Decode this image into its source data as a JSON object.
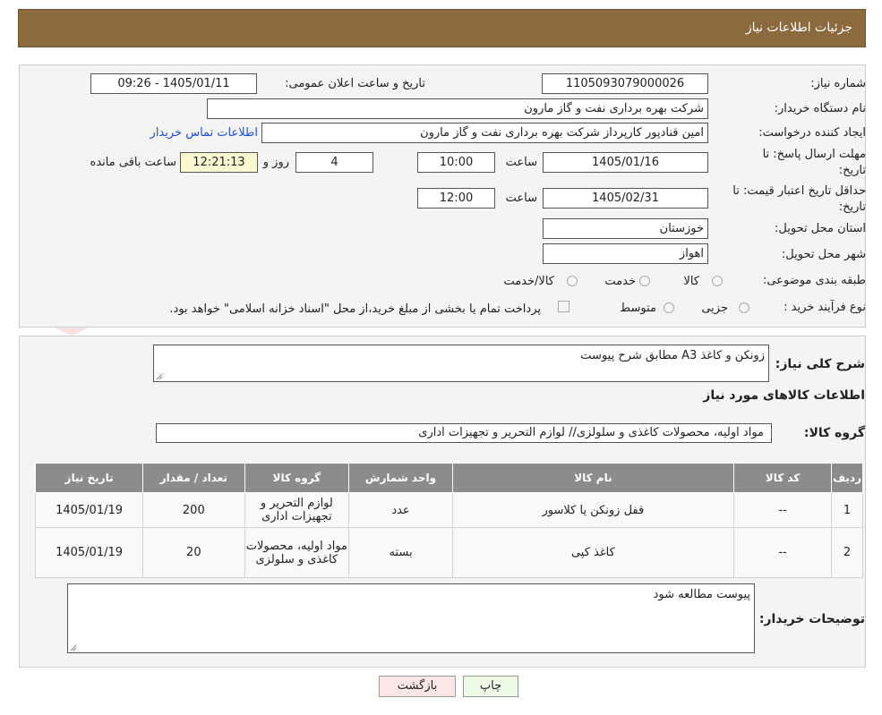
{
  "header": {
    "title": "جزئیات اطلاعات نیاز"
  },
  "form": {
    "need_number_label": "شماره نیاز:",
    "need_number": "1105093079000026",
    "announce_label": "تاریخ و ساعت اعلان عمومی:",
    "announce_value": "1405/01/11 - 09:26",
    "buyer_label": "نام دستگاه خریدار:",
    "buyer_value": "شرکت بهره برداری نفت و گاز مارون",
    "creator_label": "ایجاد کننده درخواست:",
    "creator_value": "امین قنادپور کارپرداز شرکت بهره برداری نفت و گاز مارون",
    "contact_link": "اطلاعات تماس خریدار",
    "reply_deadline_label_1": "مهلت ارسال پاسخ: تا",
    "reply_deadline_label_2": "تاریخ:",
    "reply_date": "1405/01/16",
    "time_label": "ساعت",
    "reply_time": "10:00",
    "days_value": "4",
    "days_label": "روز و",
    "remaining_time": "12:21:13",
    "remaining_label": "ساعت باقی مانده",
    "price_deadline_label_1": "حداقل تاریخ اعتبار قیمت: تا",
    "price_deadline_label_2": "تاریخ:",
    "price_date": "1405/02/31",
    "price_time": "12:00",
    "province_label": "استان محل تحویل:",
    "province_value": "خوزستان",
    "city_label": "شهر محل تحویل:",
    "city_value": "اهواز",
    "category_label": "طبقه بندی موضوعی:",
    "category_options": [
      "کالا",
      "خدمت",
      "کالا/خدمت"
    ],
    "process_label": "نوع فرآیند خرید :",
    "process_options": [
      "جزیی",
      "متوسط"
    ],
    "payment_note": "پرداخت تمام یا بخشی از مبلغ خرید،از محل \"اسناد خزانه اسلامی\" خواهد بود."
  },
  "details": {
    "summary_label": "شرح کلی نیاز:",
    "summary_value": "زونکن و کاغذ A3 مطابق شرح پیوست",
    "goods_info_title": "اطلاعات کالاهای مورد نیاز",
    "group_label": "گروه کالا:",
    "group_value": "مواد اولیه، محصولات کاغذی و سلولزی// لوازم التحریر و تجهیزات اداری",
    "table": {
      "headers": [
        "ردیف",
        "کد کالا",
        "نام کالا",
        "واحد شمارش",
        "گروه کالا",
        "تعداد / مقدار",
        "تاریخ نیاز"
      ],
      "rows": [
        [
          "1",
          "--",
          "قفل زونکن یا کلاسور",
          "عدد",
          "لوازم التحریر و تجهیزات اداری",
          "200",
          "1405/01/19"
        ],
        [
          "2",
          "--",
          "کاغذ کپی",
          "بسته",
          "مواد اولیه، محصولات کاغذی و سلولزی",
          "20",
          "1405/01/19"
        ]
      ]
    },
    "buyer_notes_label": "توضیحات خریدار:",
    "buyer_notes_value": "پیوست مطالعه شود"
  },
  "buttons": {
    "print": "چاپ",
    "back": "بازگشت"
  },
  "watermark": {
    "text": "AriaTender.neT"
  },
  "colors": {
    "header": "#8b6a3e",
    "table_header": "#8c8c8c",
    "link": "#1f4fd1",
    "remaining_bg": "#fbf7d0",
    "print_bg": "#eefbe6",
    "back_bg": "#fbe6e6"
  }
}
